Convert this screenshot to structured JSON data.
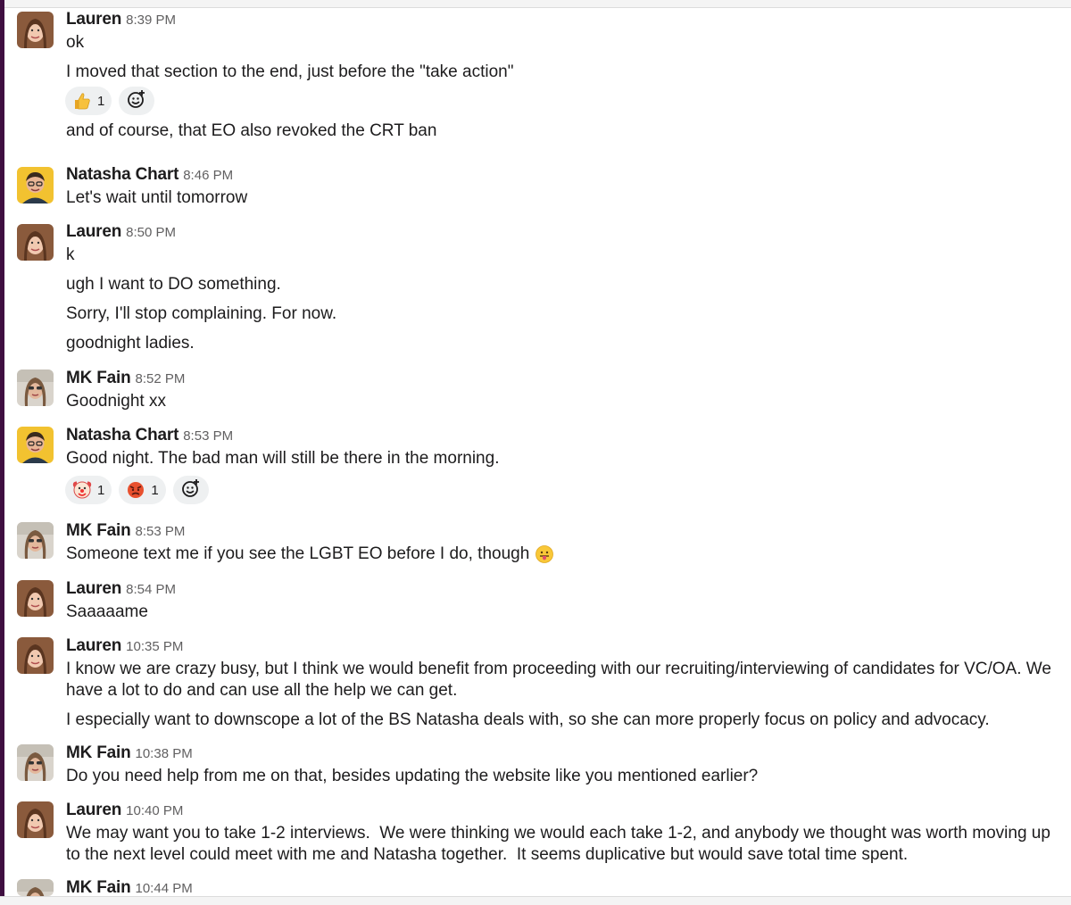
{
  "colors": {
    "workspace_bar": "#3f0e40",
    "timestamp": "#616061",
    "reaction_bg": "#eef0f1"
  },
  "messages": [
    {
      "author": "Lauren",
      "time": "8:39 PM",
      "avatar": "lauren",
      "lines": [
        "ok",
        "I moved that section to the end, just before the \"take action\""
      ],
      "reactions": [
        {
          "emoji": "thumbs-up",
          "count": "1"
        }
      ],
      "after": [
        "and of course, that EO also revoked the CRT ban"
      ]
    },
    {
      "author": "Natasha Chart",
      "time": "8:46 PM",
      "avatar": "natasha",
      "lines": [
        "Let's wait until tomorrow"
      ]
    },
    {
      "author": "Lauren",
      "time": "8:50 PM",
      "avatar": "lauren",
      "lines": [
        "k",
        "ugh I want to DO something.",
        "Sorry, I'll stop complaining. For now.",
        "goodnight ladies."
      ]
    },
    {
      "author": "MK Fain",
      "time": "8:52 PM",
      "avatar": "mk",
      "lines": [
        "Goodnight xx"
      ]
    },
    {
      "author": "Natasha Chart",
      "time": "8:53 PM",
      "avatar": "natasha",
      "lines": [
        "Good night. The bad man will still be there in the morning."
      ],
      "reactions": [
        {
          "emoji": "clown-face",
          "count": "1"
        },
        {
          "emoji": "angry-face",
          "count": "1"
        }
      ]
    },
    {
      "author": "MK Fain",
      "time": "8:53 PM",
      "avatar": "mk",
      "lines": [
        "Someone text me if you see the LGBT EO before I do, though"
      ]
    },
    {
      "author": "Lauren",
      "time": "8:54 PM",
      "avatar": "lauren",
      "lines": [
        "Saaaaame"
      ]
    },
    {
      "author": "Lauren",
      "time": "10:35 PM",
      "avatar": "lauren",
      "lines": [
        "I know we are crazy busy, but I think we would benefit from proceeding with our recruiting/interviewing of candidates for VC/OA. We have a lot to do and can use all the help we can get.",
        "I especially want to downscope a lot of the BS Natasha deals with, so she can more properly focus on policy and advocacy."
      ]
    },
    {
      "author": "MK Fain",
      "time": "10:38 PM",
      "avatar": "mk",
      "lines": [
        "Do you need help from me on that, besides updating the website like you mentioned earlier?"
      ]
    },
    {
      "author": "Lauren",
      "time": "10:40 PM",
      "avatar": "lauren",
      "lines": [
        "We may want you to take 1-2 interviews.  We were thinking we would each take 1-2, and anybody we thought was worth moving up to the next level could meet with me and Natasha together.  It seems duplicative but would save total time spent."
      ]
    },
    {
      "author": "MK Fain",
      "time": "10:44 PM",
      "avatar": "mk",
      "lines": []
    }
  ]
}
